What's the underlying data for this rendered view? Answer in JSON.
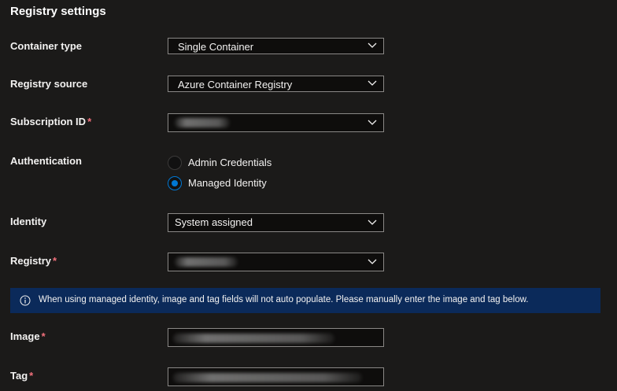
{
  "section": {
    "title": "Registry settings"
  },
  "fields": {
    "container_type": {
      "label": "Container type",
      "value": "Single Container"
    },
    "registry_source": {
      "label": "Registry source",
      "value": "Azure Container Registry"
    },
    "subscription_id": {
      "label": "Subscription ID",
      "required_mark": "*",
      "value_redacted": true
    },
    "authentication": {
      "label": "Authentication",
      "options": [
        "Admin Credentials",
        "Managed Identity"
      ],
      "selected": "Managed Identity"
    },
    "identity": {
      "label": "Identity",
      "value": "System assigned"
    },
    "registry": {
      "label": "Registry",
      "required_mark": "*",
      "value_redacted": true
    },
    "image": {
      "label": "Image",
      "required_mark": "*",
      "value_redacted": true
    },
    "tag": {
      "label": "Tag",
      "required_mark": "*",
      "value_redacted": true
    }
  },
  "info_banner": {
    "icon": "info-icon",
    "text": "When using managed identity, image and tag fields will not auto populate. Please manually enter the image and tag below."
  },
  "colors": {
    "background": "#1b1a19",
    "banner": "#0b2a5a",
    "accent": "#0078d4",
    "required": "#f1707b"
  }
}
